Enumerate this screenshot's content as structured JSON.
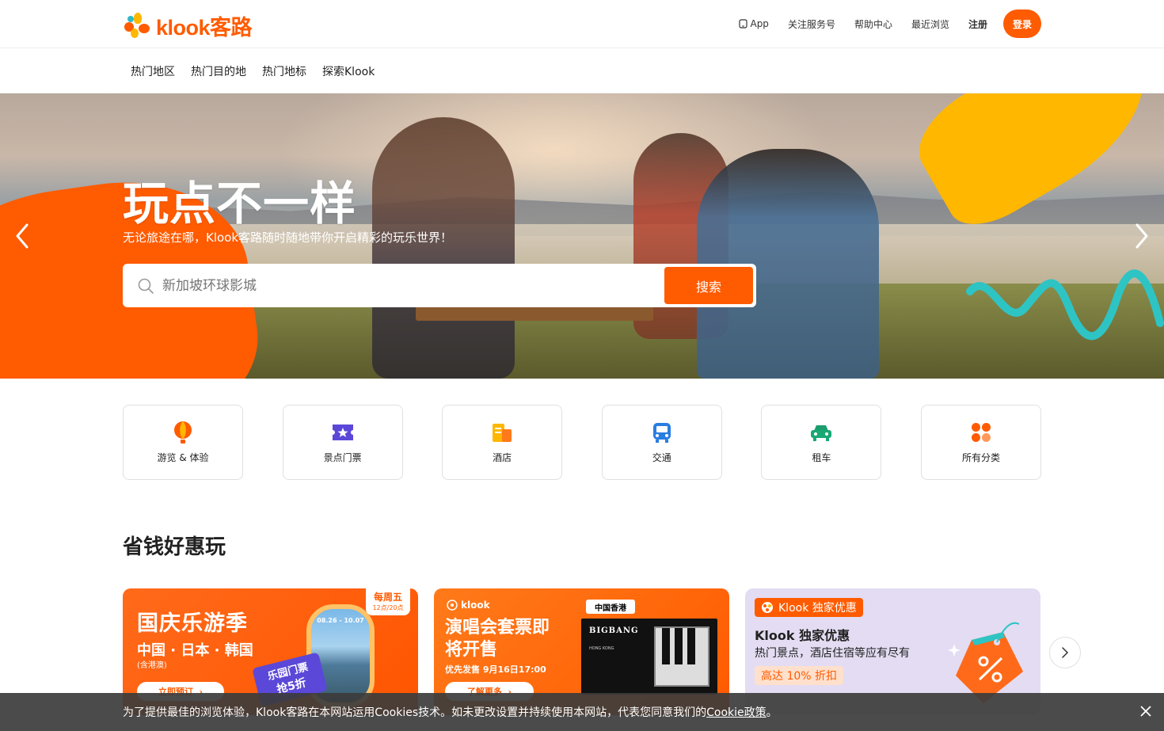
{
  "header": {
    "logo_text": "klook客路",
    "links": {
      "app": "App",
      "follow": "关注服务号",
      "help": "帮助中心",
      "recent": "最近浏览",
      "register": "注册"
    },
    "login": "登录",
    "brand_color": "#ff5b00"
  },
  "subnav": [
    "热门地区",
    "热门目的地",
    "热门地标",
    "探索Klook"
  ],
  "hero": {
    "title": "玩点不一样",
    "subtitle": "无论旅途在哪，Klook客路随时随地带你开启精彩的玩乐世界！",
    "search_placeholder": "新加坡环球影城",
    "search_button": "搜索",
    "prev_icon": "chevron-left-icon",
    "next_icon": "chevron-right-icon"
  },
  "categories": [
    {
      "label": "游览 & 体验",
      "icon": "balloon-icon"
    },
    {
      "label": "景点门票",
      "icon": "ticket-icon"
    },
    {
      "label": "酒店",
      "icon": "hotel-icon"
    },
    {
      "label": "交通",
      "icon": "bus-icon"
    },
    {
      "label": "租车",
      "icon": "car-icon"
    },
    {
      "label": "所有分类",
      "icon": "grid-icon"
    }
  ],
  "deals_section": {
    "title": "省钱好惠玩",
    "deals": [
      {
        "badge_line1": "每周五",
        "badge_line2": "12点/20点",
        "title": "国庆乐游季",
        "subtitle": "中国 · 日本 · 韩国",
        "note": "(含港澳)",
        "button": "立即预订",
        "dates": "08.26 - 10.07",
        "stamp_line1": "乐园门票",
        "stamp_line2": "抢5折"
      },
      {
        "logo": "klook",
        "tag": "中国香港",
        "title": "演唱会套票即将开售",
        "time": "优先发售 9月16日17:00",
        "button": "了解更多",
        "poster_title": "BIGBANG",
        "poster_lines": "HONG KONG"
      },
      {
        "tag": "Klook 独家优惠",
        "title": "Klook 独家优惠",
        "subtitle": "热门景点，酒店住宿等应有尽有",
        "discount": "高达 10% 折扣"
      }
    ]
  },
  "cookie": {
    "text": "为了提供最佳的浏览体验，Klook客路在本网站运用Cookies技术。如未更改设置并持续使用本网站，代表您同意我们的",
    "link": "Cookie政策",
    "suffix": "。"
  }
}
